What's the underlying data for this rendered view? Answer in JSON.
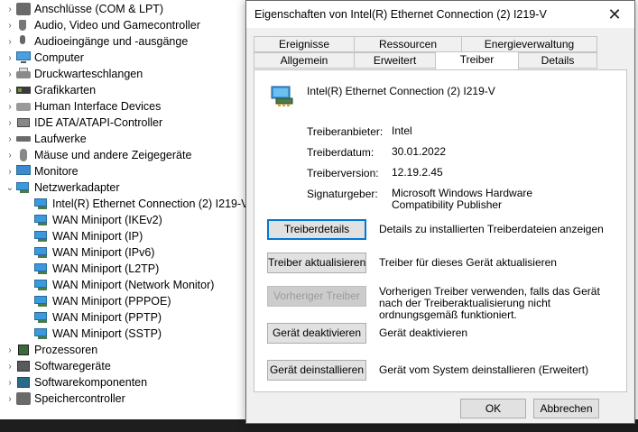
{
  "tree": {
    "items": [
      {
        "label": "Anschlüsse (COM & LPT)",
        "expanded": false,
        "icon": "port-icon",
        "level": 0
      },
      {
        "label": "Audio, Video und Gamecontroller",
        "expanded": false,
        "icon": "audio-icon",
        "level": 0
      },
      {
        "label": "Audioeingänge und -ausgänge",
        "expanded": false,
        "icon": "microphone-icon",
        "level": 0
      },
      {
        "label": "Computer",
        "expanded": false,
        "icon": "computer-icon",
        "level": 0
      },
      {
        "label": "Druckwarteschlangen",
        "expanded": false,
        "icon": "printer-icon",
        "level": 0
      },
      {
        "label": "Grafikkarten",
        "expanded": false,
        "icon": "graphics-card-icon",
        "level": 0
      },
      {
        "label": "Human Interface Devices",
        "expanded": false,
        "icon": "hid-icon",
        "level": 0
      },
      {
        "label": "IDE ATA/ATAPI-Controller",
        "expanded": false,
        "icon": "ide-controller-icon",
        "level": 0
      },
      {
        "label": "Laufwerke",
        "expanded": false,
        "icon": "drive-icon",
        "level": 0
      },
      {
        "label": "Mäuse und andere Zeigegeräte",
        "expanded": false,
        "icon": "mouse-icon",
        "level": 0
      },
      {
        "label": "Monitore",
        "expanded": false,
        "icon": "monitor-icon",
        "level": 0
      },
      {
        "label": "Netzwerkadapter",
        "expanded": true,
        "icon": "network-adapter-icon",
        "level": 0
      },
      {
        "label": "Intel(R) Ethernet Connection (2) I219-V",
        "icon": "network-adapter-icon",
        "level": 1
      },
      {
        "label": "WAN Miniport (IKEv2)",
        "icon": "network-adapter-icon",
        "level": 1
      },
      {
        "label": "WAN Miniport (IP)",
        "icon": "network-adapter-icon",
        "level": 1
      },
      {
        "label": "WAN Miniport (IPv6)",
        "icon": "network-adapter-icon",
        "level": 1
      },
      {
        "label": "WAN Miniport (L2TP)",
        "icon": "network-adapter-icon",
        "level": 1
      },
      {
        "label": "WAN Miniport (Network Monitor)",
        "icon": "network-adapter-icon",
        "level": 1
      },
      {
        "label": "WAN Miniport (PPPOE)",
        "icon": "network-adapter-icon",
        "level": 1
      },
      {
        "label": "WAN Miniport (PPTP)",
        "icon": "network-adapter-icon",
        "level": 1
      },
      {
        "label": "WAN Miniport (SSTP)",
        "icon": "network-adapter-icon",
        "level": 1
      },
      {
        "label": "Prozessoren",
        "expanded": false,
        "icon": "processor-icon",
        "level": 0
      },
      {
        "label": "Softwaregeräte",
        "expanded": false,
        "icon": "software-device-icon",
        "level": 0
      },
      {
        "label": "Softwarekomponenten",
        "expanded": false,
        "icon": "software-component-icon",
        "level": 0
      },
      {
        "label": "Speichercontroller",
        "expanded": false,
        "icon": "storage-controller-icon",
        "level": 0
      }
    ]
  },
  "dialog": {
    "title": "Eigenschaften von Intel(R) Ethernet Connection (2) I219-V",
    "tabs_row1": [
      "Ereignisse",
      "Ressourcen",
      "Energieverwaltung"
    ],
    "tabs_row2": [
      "Allgemein",
      "Erweitert",
      "Treiber",
      "Details"
    ],
    "active_tab": "Treiber",
    "device_name": "Intel(R) Ethernet Connection (2) I219-V",
    "props": {
      "provider_label": "Treiberanbieter:",
      "provider_value": "Intel",
      "date_label": "Treiberdatum:",
      "date_value": "30.01.2022",
      "version_label": "Treiberversion:",
      "version_value": "12.19.2.45",
      "signer_label": "Signaturgeber:",
      "signer_value": "Microsoft Windows Hardware Compatibility Publisher"
    },
    "actions": {
      "details_button": "Treiberdetails",
      "details_desc": "Details zu installierten Treiberdateien anzeigen",
      "update_button": "Treiber aktualisieren",
      "update_desc": "Treiber für dieses Gerät aktualisieren",
      "rollback_button": "Vorheriger Treiber",
      "rollback_desc": "Vorherigen Treiber verwenden, falls das Gerät nach der Treiberaktualisierung nicht ordnungsgemäß funktioniert.",
      "disable_button": "Gerät deaktivieren",
      "disable_desc": "Gerät deaktivieren",
      "uninstall_button": "Gerät deinstallieren",
      "uninstall_desc": "Gerät vom System deinstallieren (Erweitert)"
    },
    "ok_label": "OK",
    "cancel_label": "Abbrechen"
  },
  "colors": {
    "accent": "#0078d7",
    "dialog_bg": "#f0f0f0",
    "button_bg": "#e1e1e1"
  }
}
